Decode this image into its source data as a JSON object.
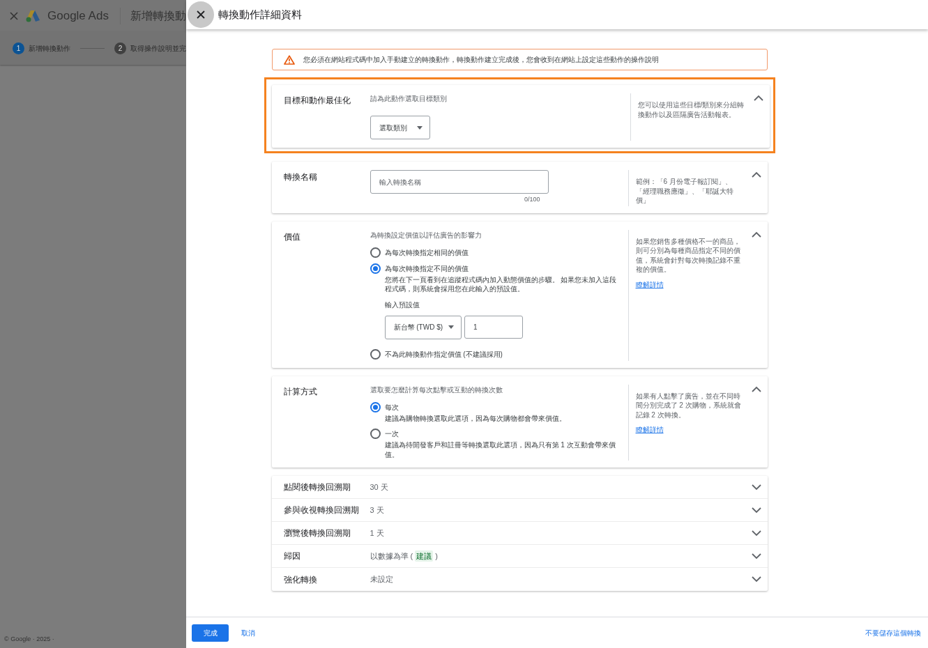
{
  "background_page": {
    "logo_text": "Google Ads",
    "page_title": "新增轉換動",
    "steps": [
      {
        "number": "1",
        "label": "新增轉換動作",
        "selected": true
      },
      {
        "number": "2",
        "label": "取得操作說明並完",
        "selected": false
      }
    ],
    "footer": "© Google · 2025 ·"
  },
  "panel": {
    "title": "轉換動作詳細資料",
    "warning": "您必須在網站程式碼中加入手動建立的轉換動作，轉換動作建立完成後，您會收到在網站上設定這些動作的操作說明",
    "sections": [
      {
        "kind": "select",
        "label": "目標和動作最佳化",
        "highlighted": true,
        "expanded": true,
        "prompt": "請為此動作選取目標類別",
        "select": "選取類別",
        "help": "您可以使用這些目標/類別來分組轉換動作以及區隔廣告活動報表。"
      },
      {
        "kind": "text_input",
        "label": "轉換名稱",
        "highlighted": false,
        "expanded": true,
        "placeholder": "輸入轉換名稱",
        "counter": "0/100",
        "help": "範例：「6 月份電子報訂閱」、「經理職務應徵」、「耶誕大特價」"
      },
      {
        "kind": "radio",
        "label": "價值",
        "highlighted": false,
        "expanded": true,
        "prompt": "為轉換設定價值以評估廣告的影響力",
        "options": [
          {
            "label": "為每次轉換指定相同的價值",
            "selected": false
          },
          {
            "label": "為每次轉換指定不同的價值",
            "selected": true,
            "description": "您將在下一頁看到在追蹤程式碼內加入動態價值的步驟。 如果您未加入這段程式碼，則系統會採用您在此輸入的預設值。",
            "default_value": {
              "label": "輸入預設值",
              "currency": "新台幣 (TWD $)",
              "value": "1"
            }
          },
          {
            "label": "不為此轉換動作指定價值 (不建議採用)",
            "selected": false
          }
        ],
        "help": "如果您銷售多種價格不一的商品，則可分別為每種商品指定不同的價值，系統會針對每次轉換記錄不重複的價值。",
        "link": "瞭解詳情"
      },
      {
        "kind": "radio",
        "label": "計算方式",
        "highlighted": false,
        "expanded": true,
        "prompt": "選取要怎麼計算每次點擊或互動的轉換次數",
        "options": [
          {
            "label": "每次",
            "selected": true,
            "description": "建議為購物轉換選取此選項，因為每次購物都會帶來價值。"
          },
          {
            "label": "一次",
            "selected": false,
            "description": "建議為待開發客戶和註冊等轉換選取此選項，因為只有第 1 次互動會帶來價值。"
          }
        ],
        "help": "如果有人點擊了廣告，並在不同時間分別完成了 2 次購物，系統就會記錄 2 次轉換。",
        "link": "瞭解詳情"
      }
    ],
    "collapsed_rows": [
      {
        "label": "點閱後轉換回溯期",
        "value": "30 天",
        "expanded": false
      },
      {
        "label": "參與收視轉換回溯期",
        "value": "3 天",
        "expanded": false
      },
      {
        "label": "瀏覽後轉換回溯期",
        "value": "1 天",
        "expanded": false
      },
      {
        "label": "歸因",
        "value": "以數據為準 (",
        "tag": "建議",
        "value_end": ")",
        "expanded": false
      },
      {
        "label": "強化轉換",
        "value": "未設定",
        "expanded": false
      }
    ],
    "done_button": "完成",
    "cancel_link": "取消",
    "discard_link": "不要儲存這個轉換"
  }
}
